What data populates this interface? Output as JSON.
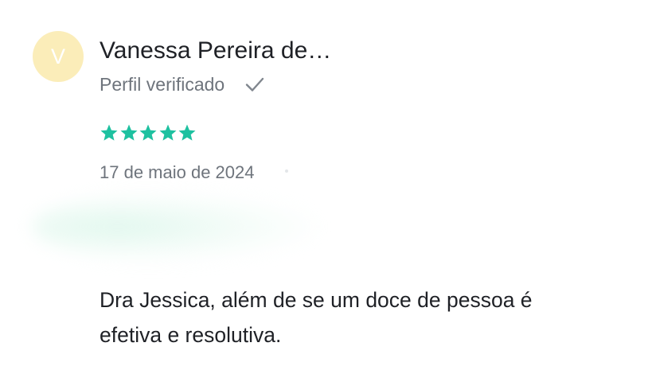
{
  "review": {
    "avatar_letter": "V",
    "author_name": "Vanessa Pereira de…",
    "verified_label": "Perfil verificado",
    "rating": 5,
    "rating_max": 5,
    "date": "17 de maio de 2024",
    "comment_line1": "Dra Jessica, além de se um doce de pessoa é",
    "comment_line2": "efetiva e resolutiva."
  },
  "colors": {
    "avatar_bg": "#fbedb9",
    "star": "#1ec1a0",
    "text_primary": "#1f2126",
    "text_secondary": "#6e747c"
  },
  "icons": {
    "check": "check-icon",
    "star": "star-icon"
  }
}
